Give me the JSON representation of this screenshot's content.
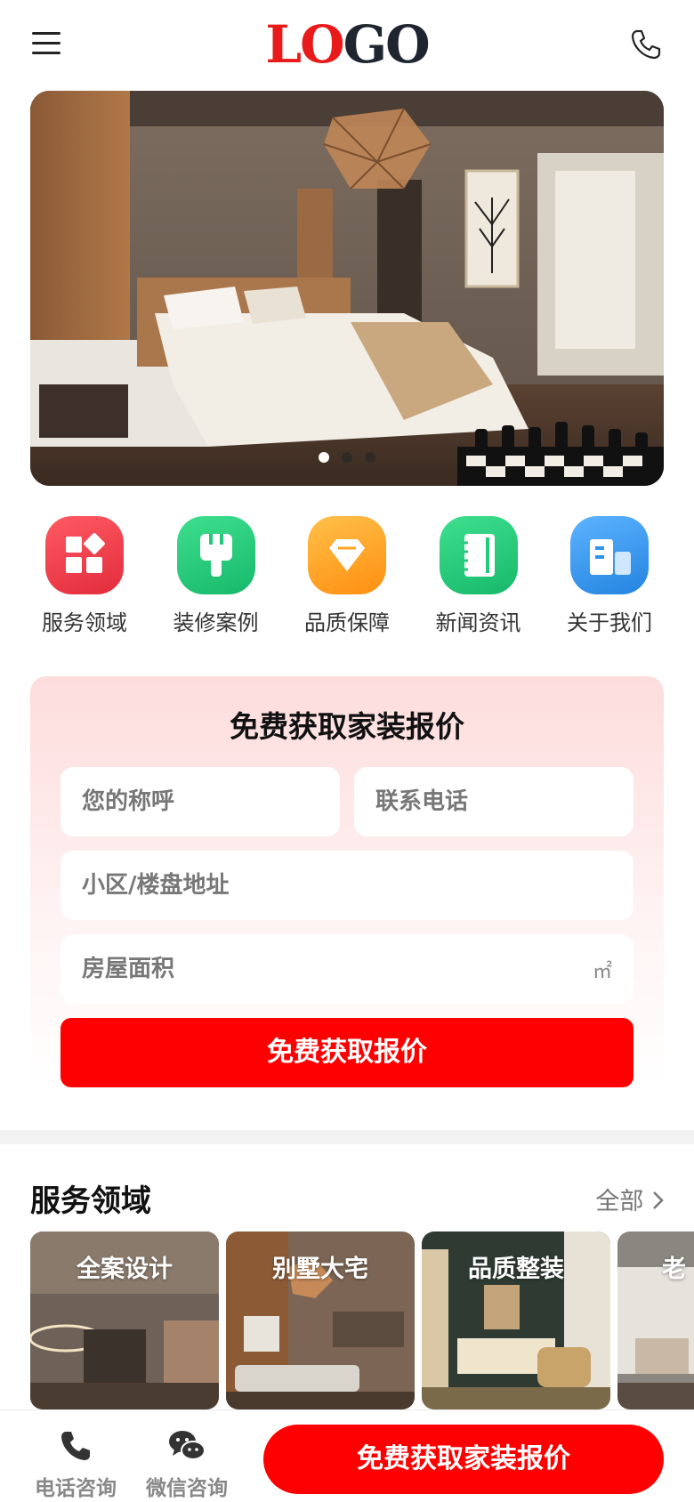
{
  "header": {
    "logo_part1": "LO",
    "logo_part2": "GO",
    "menu_icon": "hamburger-menu-icon",
    "phone_icon": "phone-icon"
  },
  "banner": {
    "slides": 3,
    "active_slide": 1
  },
  "nav": {
    "items": [
      {
        "label": "服务领域",
        "icon": "grid-icon",
        "color": "#f0404e"
      },
      {
        "label": "装修案例",
        "icon": "plug-icon",
        "color": "#22c77a"
      },
      {
        "label": "品质保障",
        "icon": "diamond-icon",
        "color": "#ffa51f"
      },
      {
        "label": "新闻资讯",
        "icon": "notebook-icon",
        "color": "#26c97c"
      },
      {
        "label": "关于我们",
        "icon": "building-icon",
        "color": "#2f95ea"
      }
    ]
  },
  "quote": {
    "title": "免费获取家装报价",
    "name_placeholder": "您的称呼",
    "phone_placeholder": "联系电话",
    "address_placeholder": "小区/楼盘地址",
    "area_placeholder": "房屋面积",
    "area_unit": "㎡",
    "submit_label": "免费获取报价"
  },
  "services": {
    "title": "服务领域",
    "all_label": "全部",
    "cards": [
      {
        "label": "全案设计"
      },
      {
        "label": "别墅大宅"
      },
      {
        "label": "品质整装"
      },
      {
        "label": "老"
      }
    ]
  },
  "bottom_bar": {
    "phone_label": "电话咨询",
    "wechat_label": "微信咨询",
    "cta_label": "免费获取家装报价"
  },
  "colors": {
    "accent": "#ff0000",
    "logo_red": "#e81a1a",
    "logo_dark": "#1f2530"
  }
}
